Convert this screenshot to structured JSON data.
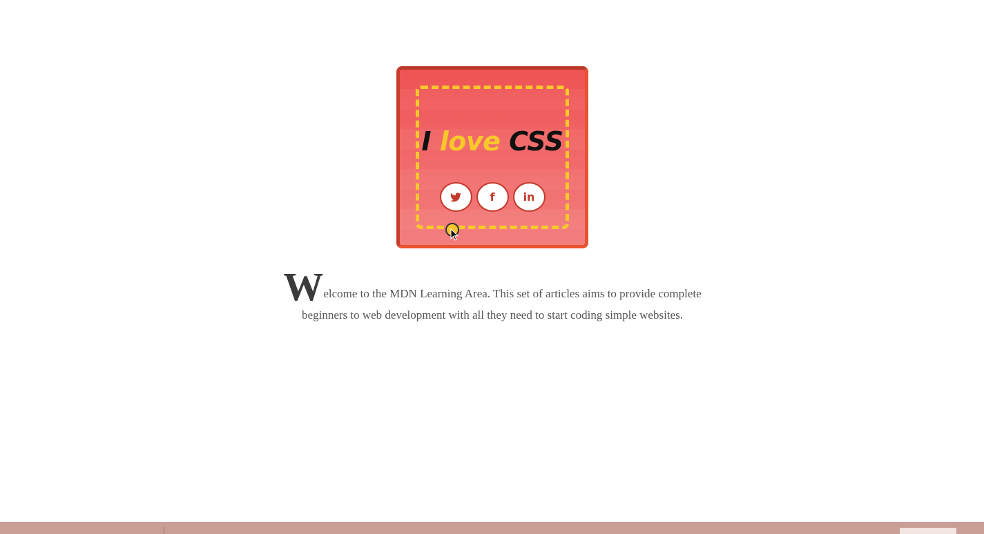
{
  "card": {
    "headline": {
      "part1": "I ",
      "part2": "love",
      "part3": " CSS"
    },
    "colors": {
      "card_bg": "#ef5354",
      "accent_yellow": "#f7c82a",
      "button_border": "#c43a2b"
    },
    "social_buttons": [
      {
        "icon": "twitter-icon"
      },
      {
        "icon": "facebook-icon",
        "glyph": "f"
      },
      {
        "icon": "linkedin-icon",
        "glyph": "in"
      }
    ]
  },
  "intro": {
    "drop_cap": "W",
    "text": "elcome to the MDN Learning Area. This set of articles aims to provide complete beginners to web development with all they need to start coding simple websites."
  }
}
